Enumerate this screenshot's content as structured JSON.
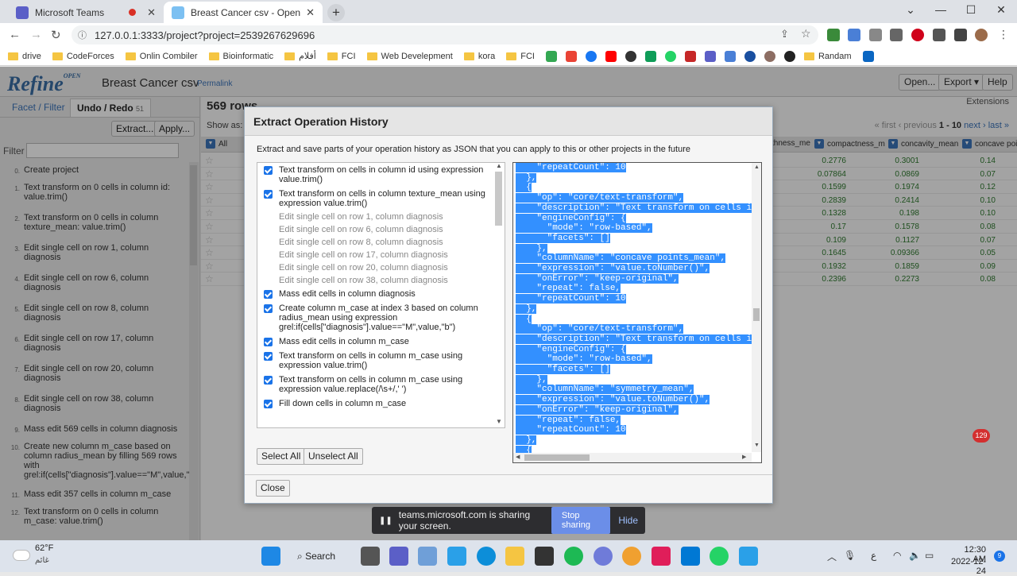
{
  "browser": {
    "tabs": [
      {
        "title": "Microsoft Teams",
        "active": false
      },
      {
        "title": "Breast Cancer csv - OpenRefine",
        "active": true
      }
    ],
    "new_tab_label": "+",
    "url": "127.0.0.1:3333/project?project=2539267629696",
    "bookmarks": [
      "drive",
      "CodeForces",
      "Onlin Combiler",
      "Bioinformatic",
      "أفلام",
      "FCI",
      "Web Develepment",
      "kora",
      "FCI",
      "Randam"
    ]
  },
  "header": {
    "logo": "Refine",
    "logo_sup": "OPEN",
    "project_name": "Breast Cancer csv",
    "permalink": "Permalink",
    "buttons": {
      "open": "Open...",
      "export": "Export ▾",
      "help": "Help"
    }
  },
  "left": {
    "tab_facet": "Facet / Filter",
    "tab_undo": "Undo / Redo",
    "undo_count": "51",
    "extract_btn": "Extract...",
    "apply_btn": "Apply...",
    "filter_label": "Filter",
    "history": [
      {
        "num": "0.",
        "text": "Create project"
      },
      {
        "num": "1.",
        "text": "Text transform on 0 cells in column id: value.trim()"
      },
      {
        "num": "2.",
        "text": "Text transform on 0 cells in column texture_mean: value.trim()"
      },
      {
        "num": "3.",
        "text": "Edit single cell on row 1, column diagnosis"
      },
      {
        "num": "4.",
        "text": "Edit single cell on row 6, column diagnosis"
      },
      {
        "num": "5.",
        "text": "Edit single cell on row 8, column diagnosis"
      },
      {
        "num": "6.",
        "text": "Edit single cell on row 17, column diagnosis"
      },
      {
        "num": "7.",
        "text": "Edit single cell on row 20, column diagnosis"
      },
      {
        "num": "8.",
        "text": "Edit single cell on row 38, column diagnosis"
      },
      {
        "num": "9.",
        "text": "Mass edit 569 cells in column diagnosis"
      },
      {
        "num": "10.",
        "text": "Create new column m_case based on column radius_mean by filling 569 rows with grel:if(cells[\"diagnosis\"].value==\"M\",value,\""
      },
      {
        "num": "11.",
        "text": "Mass edit 357 cells in column m_case"
      },
      {
        "num": "12.",
        "text": "Text transform on 0 cells in column m_case: value.trim()"
      }
    ]
  },
  "data": {
    "row_count": "569 rows",
    "extensions": "Extensions",
    "show_as": "Show as:",
    "pager": {
      "first": "« first",
      "previous": "‹ previous",
      "range": "1 - 10",
      "next": "next ›",
      "last": "last »"
    },
    "all_label": "All",
    "columns": [
      "thness_me",
      "compactness_m",
      "concavity_mean",
      "concave poi"
    ],
    "rows": [
      [
        "0.1184",
        "0.2776",
        "0.3001",
        "0.14"
      ],
      [
        "0.08474",
        "0.07864",
        "0.0869",
        "0.07"
      ],
      [
        "0.1096",
        "0.1599",
        "0.1974",
        "0.12"
      ],
      [
        "0.1425",
        "0.2839",
        "0.2414",
        "0.10"
      ],
      [
        "0.1003",
        "0.1328",
        "0.198",
        "0.10"
      ],
      [
        "0.1278",
        "0.17",
        "0.1578",
        "0.08"
      ],
      [
        "0.09463",
        "0.109",
        "0.1127",
        "0.07"
      ],
      [
        "0.1189",
        "0.1645",
        "0.09366",
        "0.05"
      ],
      [
        "0.1273",
        "0.1932",
        "0.1859",
        "0.09"
      ],
      [
        "0.1186",
        "0.2396",
        "0.2273",
        "0.08"
      ]
    ]
  },
  "dialog": {
    "title": "Extract Operation History",
    "description": "Extract and save parts of your operation history as JSON that you can apply to this or other projects in the future",
    "operations": [
      {
        "label": "Text transform on cells in column id using expression value.trim()",
        "checked": true
      },
      {
        "label": "Text transform on cells in column texture_mean using expression value.trim()",
        "checked": true
      },
      {
        "label": "Edit single cell on row 1, column diagnosis",
        "checked": null
      },
      {
        "label": "Edit single cell on row 6, column diagnosis",
        "checked": null
      },
      {
        "label": "Edit single cell on row 8, column diagnosis",
        "checked": null
      },
      {
        "label": "Edit single cell on row 17, column diagnosis",
        "checked": null
      },
      {
        "label": "Edit single cell on row 20, column diagnosis",
        "checked": null
      },
      {
        "label": "Edit single cell on row 38, column diagnosis",
        "checked": null
      },
      {
        "label": "Mass edit cells in column diagnosis",
        "checked": true
      },
      {
        "label": "Create column m_case at index 3 based on column radius_mean using expression grel:if(cells[\"diagnosis\"].value==\"M\",value,\"b\")",
        "checked": true
      },
      {
        "label": "Mass edit cells in column m_case",
        "checked": true
      },
      {
        "label": "Text transform on cells in column m_case using expression value.trim()",
        "checked": true
      },
      {
        "label": "Text transform on cells in column m_case using expression value.replace(/\\s+/,' ')",
        "checked": true
      },
      {
        "label": "Fill down cells in column m_case",
        "checked": true
      }
    ],
    "json_lines": [
      "    \"repeatCount\": 10",
      "  },",
      "  {",
      "    \"op\": \"core/text-transform\",",
      "    \"description\": \"Text transform on cells in co",
      "    \"engineConfig\": {",
      "      \"mode\": \"row-based\",",
      "      \"facets\": []",
      "    },",
      "    \"columnName\": \"concave points_mean\",",
      "    \"expression\": \"value.toNumber()\",",
      "    \"onError\": \"keep-original\",",
      "    \"repeat\": false,",
      "    \"repeatCount\": 10",
      "  },",
      "  {",
      "    \"op\": \"core/text-transform\",",
      "    \"description\": \"Text transform on cells in co",
      "    \"engineConfig\": {",
      "      \"mode\": \"row-based\",",
      "      \"facets\": []",
      "    },",
      "    \"columnName\": \"symmetry_mean\",",
      "    \"expression\": \"value.toNumber()\",",
      "    \"onError\": \"keep-original\",",
      "    \"repeat\": false,",
      "    \"repeatCount\": 10",
      "  },",
      "  {"
    ],
    "select_all": "Select All",
    "unselect_all": "Unselect All",
    "close": "Close",
    "notif_count": "129"
  },
  "share_bar": {
    "text": "teams.microsoft.com is sharing your screen.",
    "stop": "Stop sharing",
    "hide": "Hide"
  },
  "taskbar": {
    "temp": "62°F",
    "weather": "غائم",
    "search": "Search",
    "time": "12:30 AM",
    "date": "2022-12-24",
    "lang": "ع",
    "notif": "9"
  },
  "colors": {
    "accent": "#3b73b9",
    "selection": "#3390ff",
    "checkbox": "#1a73e8"
  }
}
